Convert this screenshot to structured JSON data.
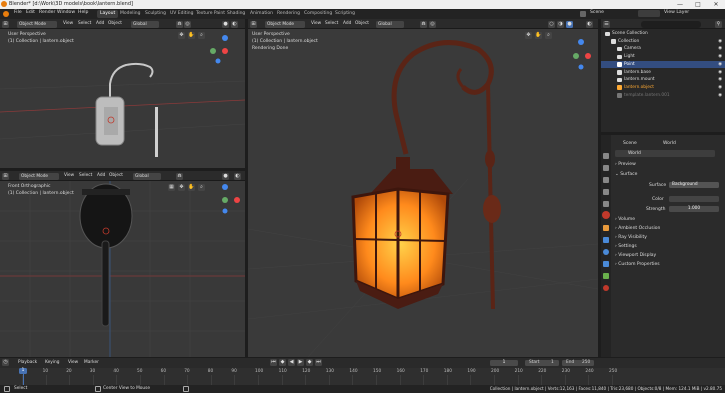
{
  "window": {
    "title": "Blender* [d:\\Work\\3D models\\book\\lantern.blend]",
    "minimize": "—",
    "maximize": "□",
    "close": "✕"
  },
  "menus": [
    "File",
    "Edit",
    "Render",
    "Window",
    "Help"
  ],
  "workspaces": [
    "Layout",
    "Modeling",
    "Sculpting",
    "UV Editing",
    "Texture Paint",
    "Shading",
    "Animation",
    "Rendering",
    "Compositing",
    "Scripting"
  ],
  "scene": {
    "label": "Scene",
    "view_layer": "View Layer"
  },
  "viewport_top_left": {
    "mode": "Object Mode",
    "menus": [
      "View",
      "Select",
      "Add",
      "Object"
    ],
    "orientation": "Global",
    "overlay1": "User Perspective",
    "overlay2": "(1) Collection | lantern.object"
  },
  "viewport_bottom_left": {
    "mode": "Object Mode",
    "menus": [
      "View",
      "Select",
      "Add",
      "Object"
    ],
    "orientation": "Global",
    "overlay1": "Front Orthographic",
    "overlay2": "(1) Collection | lantern.object"
  },
  "viewport_main": {
    "mode": "Object Mode",
    "menus": [
      "View",
      "Select",
      "Add",
      "Object"
    ],
    "orientation": "Global",
    "overlay1": "User Perspective",
    "overlay2": "(1) Collection | lantern.object",
    "overlay3": "Rendering Done"
  },
  "gizmo": {
    "x": "X",
    "y": "Y",
    "z": "Z"
  },
  "outliner": {
    "rows": [
      {
        "label": "Scene Collection",
        "indent": 0,
        "selected": false,
        "color": "#dddddd"
      },
      {
        "label": "Collection",
        "indent": 1,
        "selected": false,
        "color": "#dddddd"
      },
      {
        "label": "Camera",
        "indent": 2,
        "selected": false,
        "color": "#dddddd"
      },
      {
        "label": "Light",
        "indent": 2,
        "selected": false,
        "color": "#dddddd"
      },
      {
        "label": "Point",
        "indent": 2,
        "selected": true,
        "color": "#ffffff"
      },
      {
        "label": "lantern.base",
        "indent": 2,
        "selected": false,
        "color": "#dddddd"
      },
      {
        "label": "lantern.mount",
        "indent": 2,
        "selected": false,
        "color": "#dddddd"
      },
      {
        "label": "lantern.object",
        "indent": 2,
        "selected": false,
        "color": "#ffaa33"
      },
      {
        "label": "template.lantern.001",
        "indent": 2,
        "selected": false,
        "color": "#777777"
      }
    ]
  },
  "properties": {
    "tab_scene": "Scene",
    "tab_world": "World",
    "world_name": "World",
    "preview": "Preview",
    "surface_header": "Surface",
    "surface_label": "Surface",
    "surface_value": "Background",
    "color_label": "Color",
    "strength_label": "Strength",
    "strength_value": "1.000",
    "volume": "Volume",
    "ambient_occlusion": "Ambient Occlusion",
    "ray_visibility": "Ray Visibility",
    "settings": "Settings",
    "viewport_display": "Viewport Display",
    "custom_properties": "Custom Properties"
  },
  "timeline": {
    "menus": [
      "Playback",
      "Keying",
      "View",
      "Marker"
    ],
    "current_frame": "1",
    "start_label": "Start",
    "start": "1",
    "end_label": "End",
    "end": "250",
    "ticks": [
      "0",
      "10",
      "20",
      "30",
      "40",
      "50",
      "60",
      "70",
      "80",
      "90",
      "100",
      "110",
      "120",
      "130",
      "140",
      "150",
      "160",
      "170",
      "180",
      "190",
      "200",
      "210",
      "220",
      "230",
      "240",
      "250"
    ],
    "playhead": "1"
  },
  "statusbar": {
    "left": "Select",
    "middle": "Center View to Mouse",
    "right": "Collection | lantern.object | Verts:12,163 | Faces:11,840 | Tris:23,680 | Objects:0/8 | Mem: 124.1 MiB | v2.80.75"
  },
  "colors": {
    "accent": "#4772b3",
    "selected_row": "#334d80",
    "active_object": "#ffaa33",
    "lantern_glow": "#ff8a1c"
  }
}
